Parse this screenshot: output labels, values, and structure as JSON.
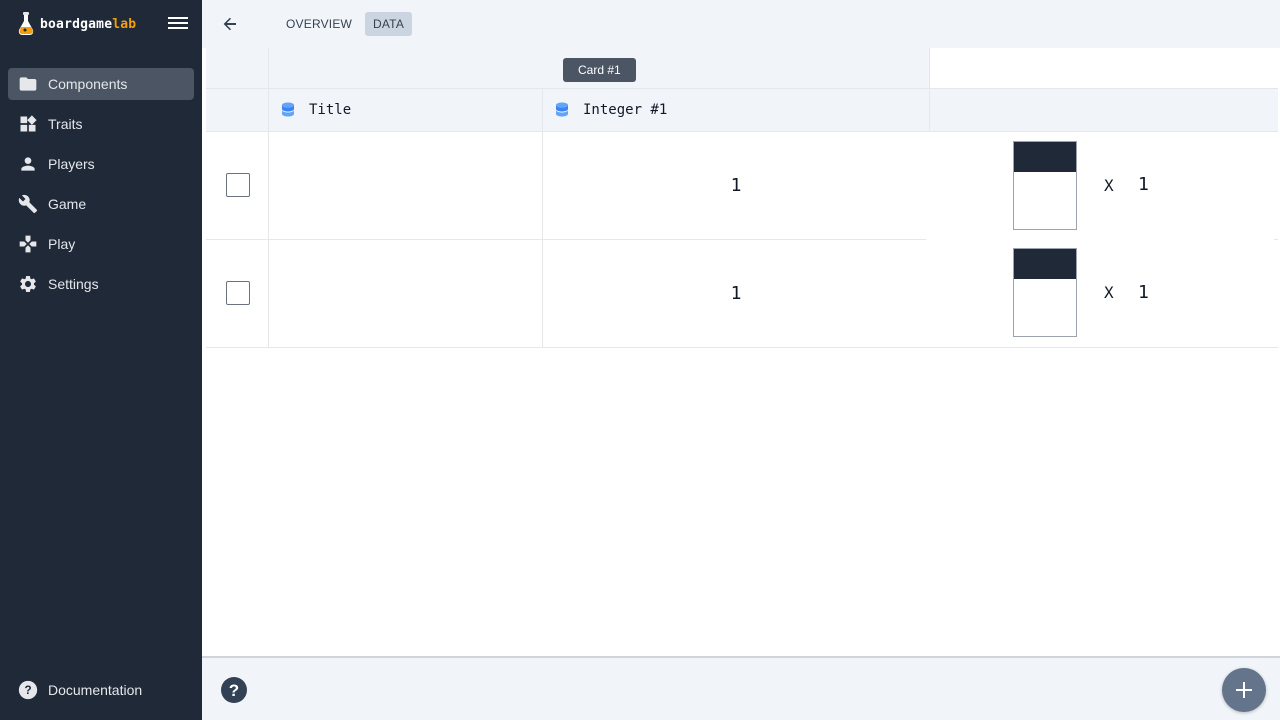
{
  "brand": {
    "name_main": "boardgame",
    "name_accent": "lab",
    "logo_icon": "flask-logo-icon"
  },
  "sidebar": {
    "items": [
      {
        "label": "Components",
        "icon": "folder-icon",
        "active": true
      },
      {
        "label": "Traits",
        "icon": "widgets-icon",
        "active": false
      },
      {
        "label": "Players",
        "icon": "person-icon",
        "active": false
      },
      {
        "label": "Game",
        "icon": "wrench-icon",
        "active": false
      },
      {
        "label": "Play",
        "icon": "gamepad-icon",
        "active": false
      },
      {
        "label": "Settings",
        "icon": "gear-icon",
        "active": false
      }
    ],
    "documentation": "Documentation"
  },
  "header": {
    "tabs": [
      {
        "label": "OVERVIEW",
        "active": false
      },
      {
        "label": "DATA",
        "active": true
      }
    ]
  },
  "table": {
    "group_label": "Card #1",
    "columns": [
      {
        "label": "Title",
        "icon": "database-icon"
      },
      {
        "label": "Integer #1",
        "icon": "database-icon"
      }
    ],
    "rows": [
      {
        "checked": false,
        "title": "",
        "integer": "1",
        "multiplier": "X",
        "quantity": "1"
      },
      {
        "checked": false,
        "title": "",
        "integer": "1",
        "multiplier": "X",
        "quantity": "1"
      }
    ]
  },
  "colors": {
    "sidebar_bg": "#1f2937",
    "accent": "#f59e0b",
    "fab_bg": "#64748b",
    "active_nav": "#4b5563"
  }
}
